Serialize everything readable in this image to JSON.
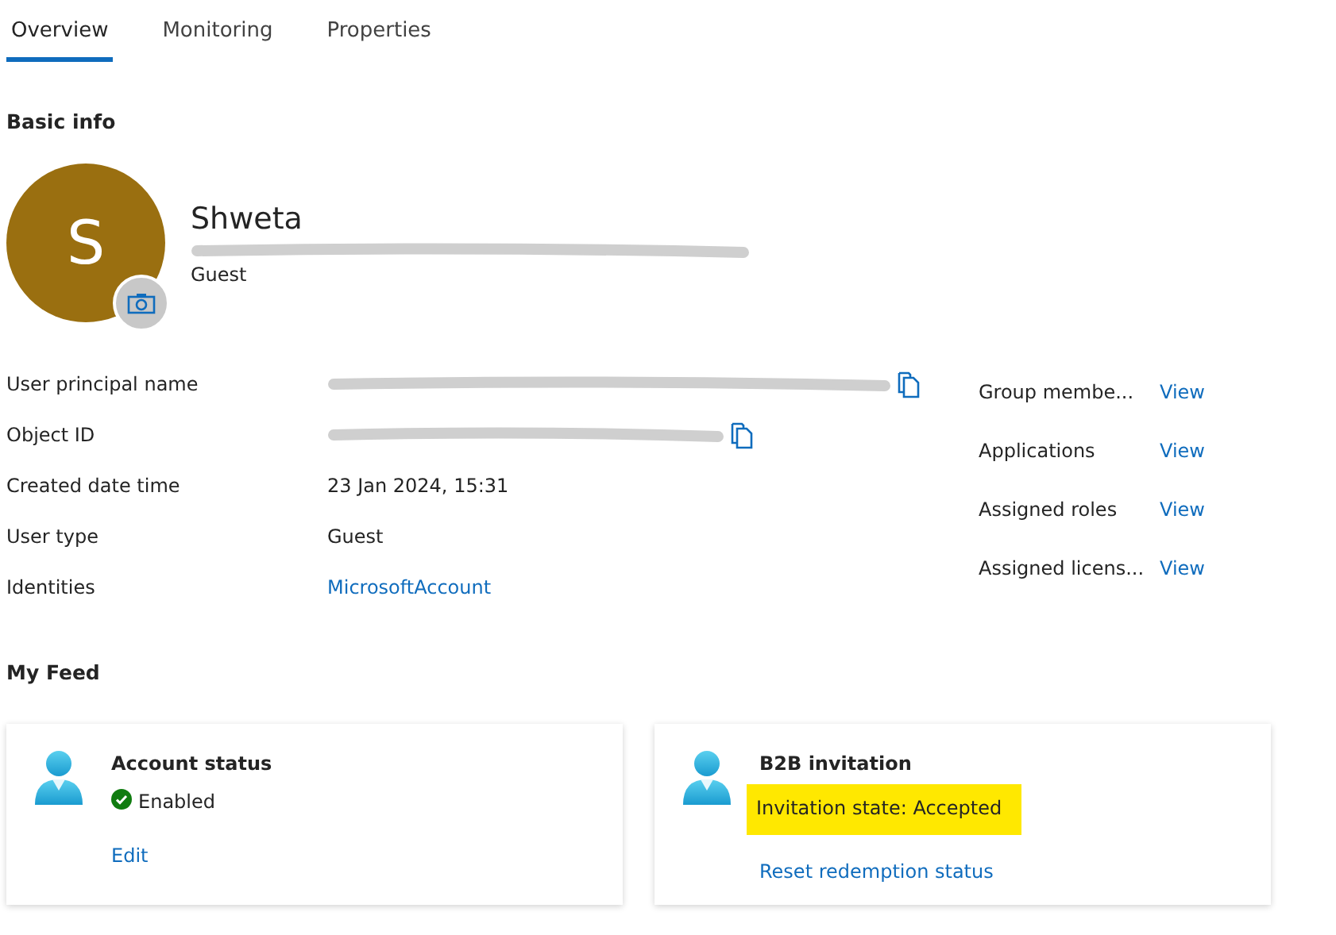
{
  "tabs": [
    {
      "label": "Overview",
      "selected": true
    },
    {
      "label": "Monitoring",
      "selected": false
    },
    {
      "label": "Properties",
      "selected": false
    }
  ],
  "basic_info": {
    "heading": "Basic info",
    "avatar_initial": "S",
    "name": "Shweta",
    "email_redacted": true,
    "user_type": "Guest"
  },
  "properties": [
    {
      "label": "User principal name",
      "copyable": true,
      "kind": "redacted"
    },
    {
      "label": "Object ID",
      "copyable": true,
      "kind": "redacted"
    },
    {
      "label": "Created date time",
      "value": "23 Jan 2024, 15:31",
      "copyable": false,
      "kind": "text"
    },
    {
      "label": "User type",
      "value": "Guest",
      "copyable": false,
      "kind": "text"
    },
    {
      "label": "Identities",
      "value": "MicrosoftAccount",
      "copyable": false,
      "kind": "link"
    }
  ],
  "links": [
    {
      "label": "Group membe...",
      "action": "View"
    },
    {
      "label": "Applications",
      "action": "View"
    },
    {
      "label": "Assigned roles",
      "action": "View"
    },
    {
      "label": "Assigned licens...",
      "action": "View"
    }
  ],
  "feed": {
    "heading": "My Feed",
    "cards": [
      {
        "title": "Account status",
        "status": "Enabled",
        "status_ok": true,
        "highlighted": false,
        "link": "Edit"
      },
      {
        "title": "B2B invitation",
        "status": "Invitation state: Accepted",
        "status_ok": false,
        "highlighted": true,
        "link": "Reset redemption status"
      }
    ]
  }
}
